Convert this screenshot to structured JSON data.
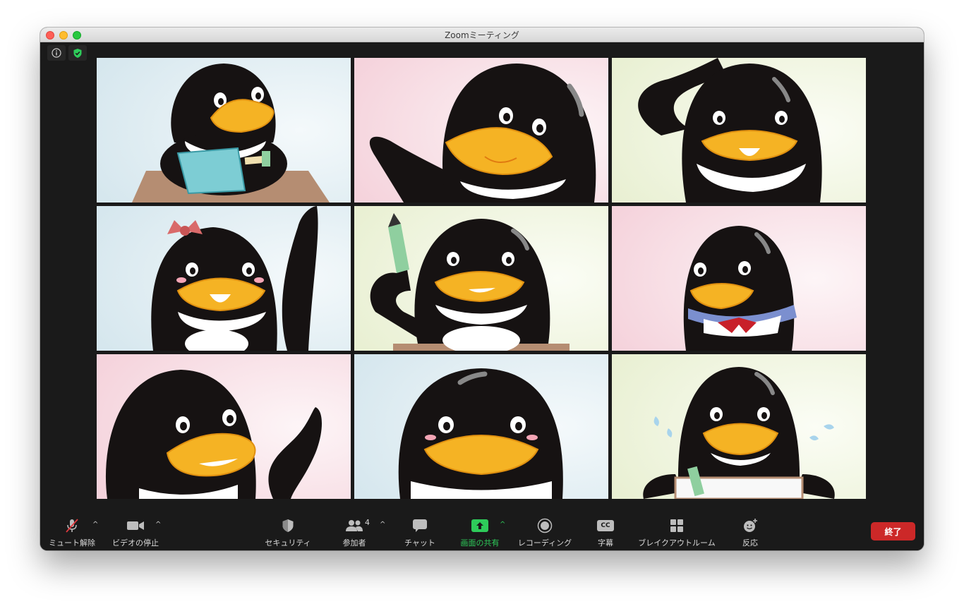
{
  "window": {
    "title": "Zoomミーティング"
  },
  "top_icons": [
    {
      "icon": "info-icon"
    },
    {
      "icon": "encryption-shield-icon",
      "color": "#2ecc5a"
    }
  ],
  "participants": [
    {
      "tile": 1,
      "background": "#dbe9ef"
    },
    {
      "tile": 2,
      "background": "#f7d9e0"
    },
    {
      "tile": 3,
      "background": "#eef3dc"
    },
    {
      "tile": 4,
      "background": "#dbe9ef"
    },
    {
      "tile": 5,
      "background": "#eef3dc"
    },
    {
      "tile": 6,
      "background": "#f7d9e0"
    },
    {
      "tile": 7,
      "background": "#f7d9e0"
    },
    {
      "tile": 8,
      "background": "#dbe9ef"
    },
    {
      "tile": 9,
      "background": "#eef3dc"
    }
  ],
  "toolbar": {
    "unmute": "ミュート解除",
    "stop_video": "ビデオの停止",
    "security": "セキュリティ",
    "participants": "参加者",
    "participant_count": "4",
    "chat": "チャット",
    "share_screen": "画面の共有",
    "recording": "レコーディング",
    "captions": "字幕",
    "captions_icon_text": "CC",
    "breakout": "ブレイクアウトルーム",
    "reactions": "反応",
    "caret": "^",
    "end": "終了"
  },
  "colors": {
    "accent_green": "#2ecc5a",
    "end_red": "#cc2828",
    "beak": "#f5b324",
    "penguin": "#161212"
  }
}
